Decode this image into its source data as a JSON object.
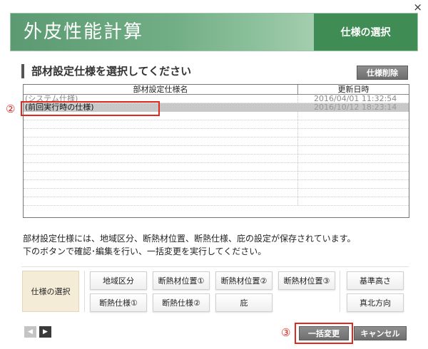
{
  "window": {
    "close_glyph": "×"
  },
  "banner": {
    "title": "外皮性能計算",
    "step_label": "仕様の選択"
  },
  "section": {
    "heading": "部材設定仕様を選択してください",
    "delete_button": "仕様削除"
  },
  "table": {
    "headers": {
      "name": "部材設定仕様名",
      "updated": "更新日時"
    },
    "rows": [
      {
        "name": "(システム仕様)",
        "updated": "2016/04/01 11:32:54",
        "selected": false
      },
      {
        "name": "(前回実行時の仕様)",
        "updated": "2016/10/12 18:23:14",
        "selected": true
      }
    ]
  },
  "annotations": {
    "step2": "②",
    "step3": "③"
  },
  "description": {
    "line1": "部材設定仕様には、地域区分、断熱材位置、断熱仕様、庇の設定が保存されています。",
    "line2": "下のボタンで確認･編集を行い、一括変更を実行してください。"
  },
  "options": {
    "spec_select": "仕様の選択",
    "region": "地域区分",
    "insul_pos_1": "断熱材位置①",
    "insul_pos_2": "断熱材位置②",
    "insul_pos_3": "断熱材位置③",
    "base_height": "基準高さ",
    "insul_spec_1": "断熱仕様①",
    "insul_spec_2": "断熱仕様②",
    "eave": "庇",
    "true_north": "真北方向"
  },
  "footer": {
    "prev": "◀",
    "next": "▶",
    "batch_change": "一括変更",
    "cancel": "キャンセル"
  },
  "colors": {
    "accent_green": "#3f8d54",
    "annotation_red": "#e0281e",
    "button_gray": "#777777"
  }
}
